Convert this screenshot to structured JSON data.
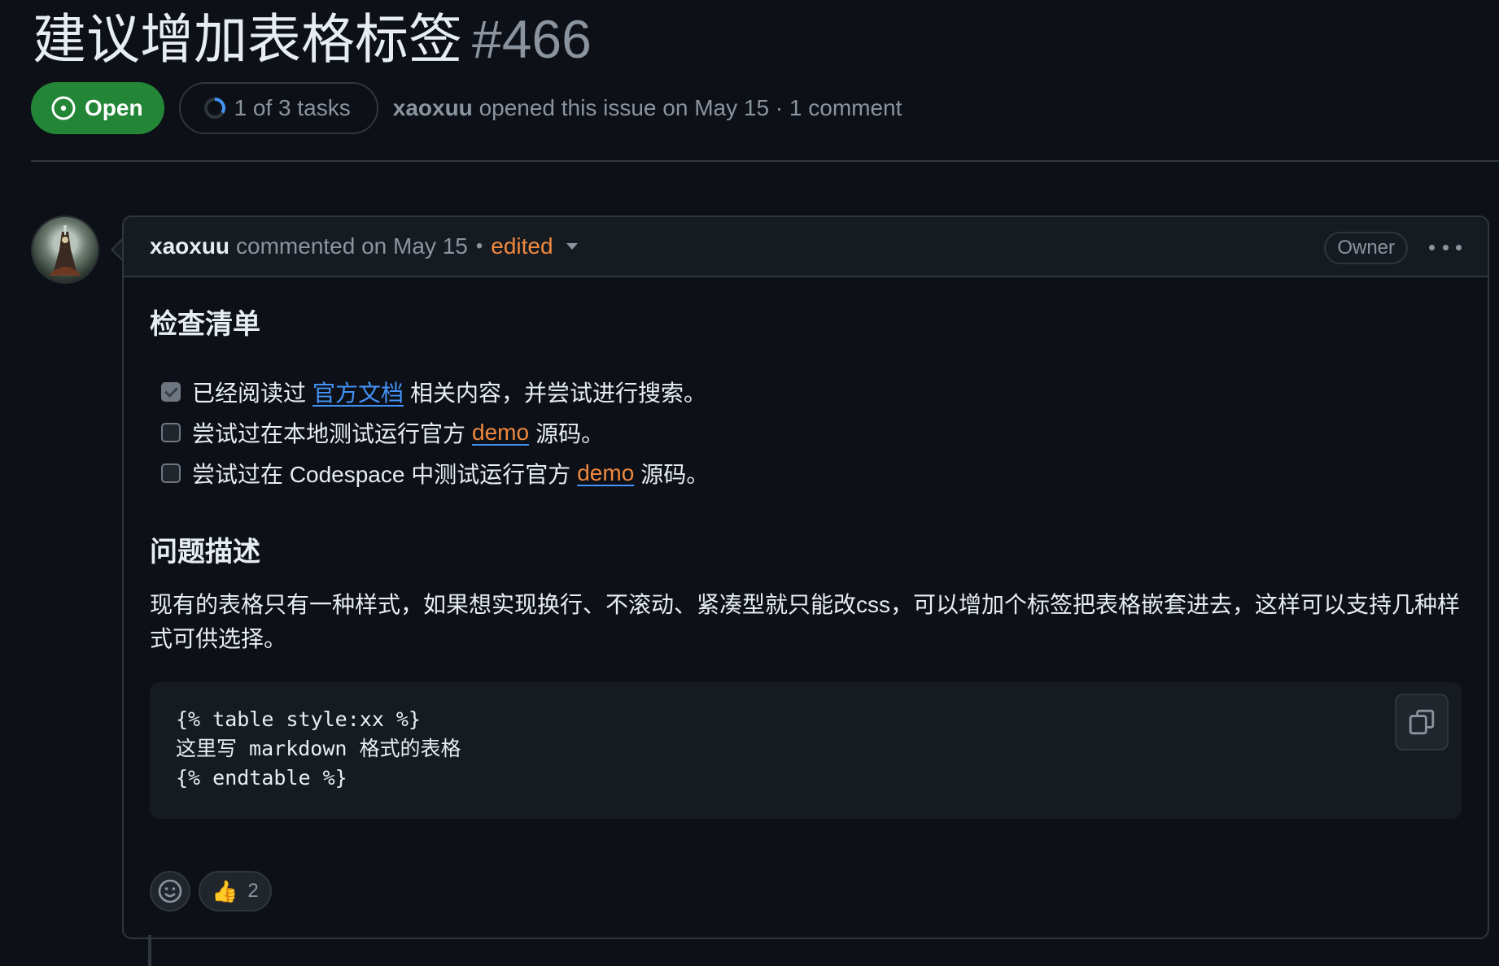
{
  "issue": {
    "title": "建议增加表格标签",
    "number": "#466",
    "state_label": "Open",
    "tasks_label": "1 of 3 tasks",
    "tasks_progress": 0.333,
    "author": "xaoxuu",
    "opened_text": "opened this issue on May 15 · 1 comment"
  },
  "comment": {
    "author": "xaoxuu",
    "when": "commented on May 15",
    "separator": "•",
    "edited_label": "edited",
    "role_badge": "Owner",
    "checklist_heading": "检查清单",
    "tasks": [
      {
        "checked": true,
        "before": "已经阅读过",
        "link": "官方文档",
        "after": "相关内容，并尝试进行搜索。"
      },
      {
        "checked": false,
        "before": "尝试过在本地测试运行官方",
        "link": "demo",
        "after": "源码。"
      },
      {
        "checked": false,
        "before": "尝试过在 Codespace 中测试运行官方",
        "link": "demo",
        "after": "源码。"
      }
    ],
    "problem_heading": "问题描述",
    "description": "现有的表格只有一种样式，如果想实现换行、不滚动、紧凑型就只能改css，可以增加个标签把表格嵌套进去，这样可以支持几种样式可供选择。",
    "code_lines": [
      "{% table style:xx %}",
      "这里写 markdown 格式的表格",
      "{% endtable %}"
    ],
    "reaction": {
      "emoji": "👍",
      "count": "2"
    }
  },
  "colors": {
    "background": "#0d1117",
    "open_green": "#238636",
    "link_blue": "#4493f8",
    "edited_orange": "#f0883e",
    "muted": "#8b949e",
    "border": "#30363d"
  },
  "icons": [
    "issue-open-icon",
    "progress-ring-icon",
    "chevron-down-icon",
    "kebab-menu-icon",
    "copy-icon",
    "smiley-icon",
    "thumbs-up-icon"
  ]
}
